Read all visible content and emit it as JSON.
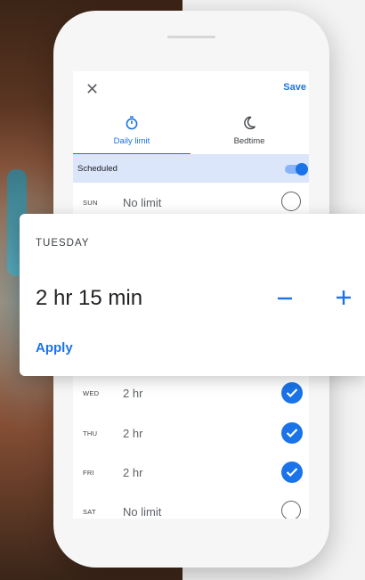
{
  "topbar": {
    "close_label": "✕",
    "save_label": "Save"
  },
  "tabs": [
    {
      "label": "Daily limit",
      "icon": "timer-icon",
      "selected": true
    },
    {
      "label": "Bedtime",
      "icon": "moon-icon",
      "selected": false
    }
  ],
  "scheduled": {
    "label": "Scheduled",
    "enabled": true
  },
  "days": [
    {
      "abbr": "SUN",
      "value": "No limit",
      "checked": false
    },
    {
      "abbr": "WED",
      "value": "2 hr",
      "checked": true
    },
    {
      "abbr": "THU",
      "value": "2 hr",
      "checked": true
    },
    {
      "abbr": "FRI",
      "value": "2 hr",
      "checked": true
    },
    {
      "abbr": "SAT",
      "value": "No limit",
      "checked": false
    }
  ],
  "card": {
    "day": "TUESDAY",
    "value": "2 hr 15 min",
    "minus_label": "−",
    "plus_label": "+",
    "apply_label": "Apply"
  },
  "colors": {
    "accent": "#1a73e8",
    "scheduled_bg": "#dbe6fb"
  }
}
